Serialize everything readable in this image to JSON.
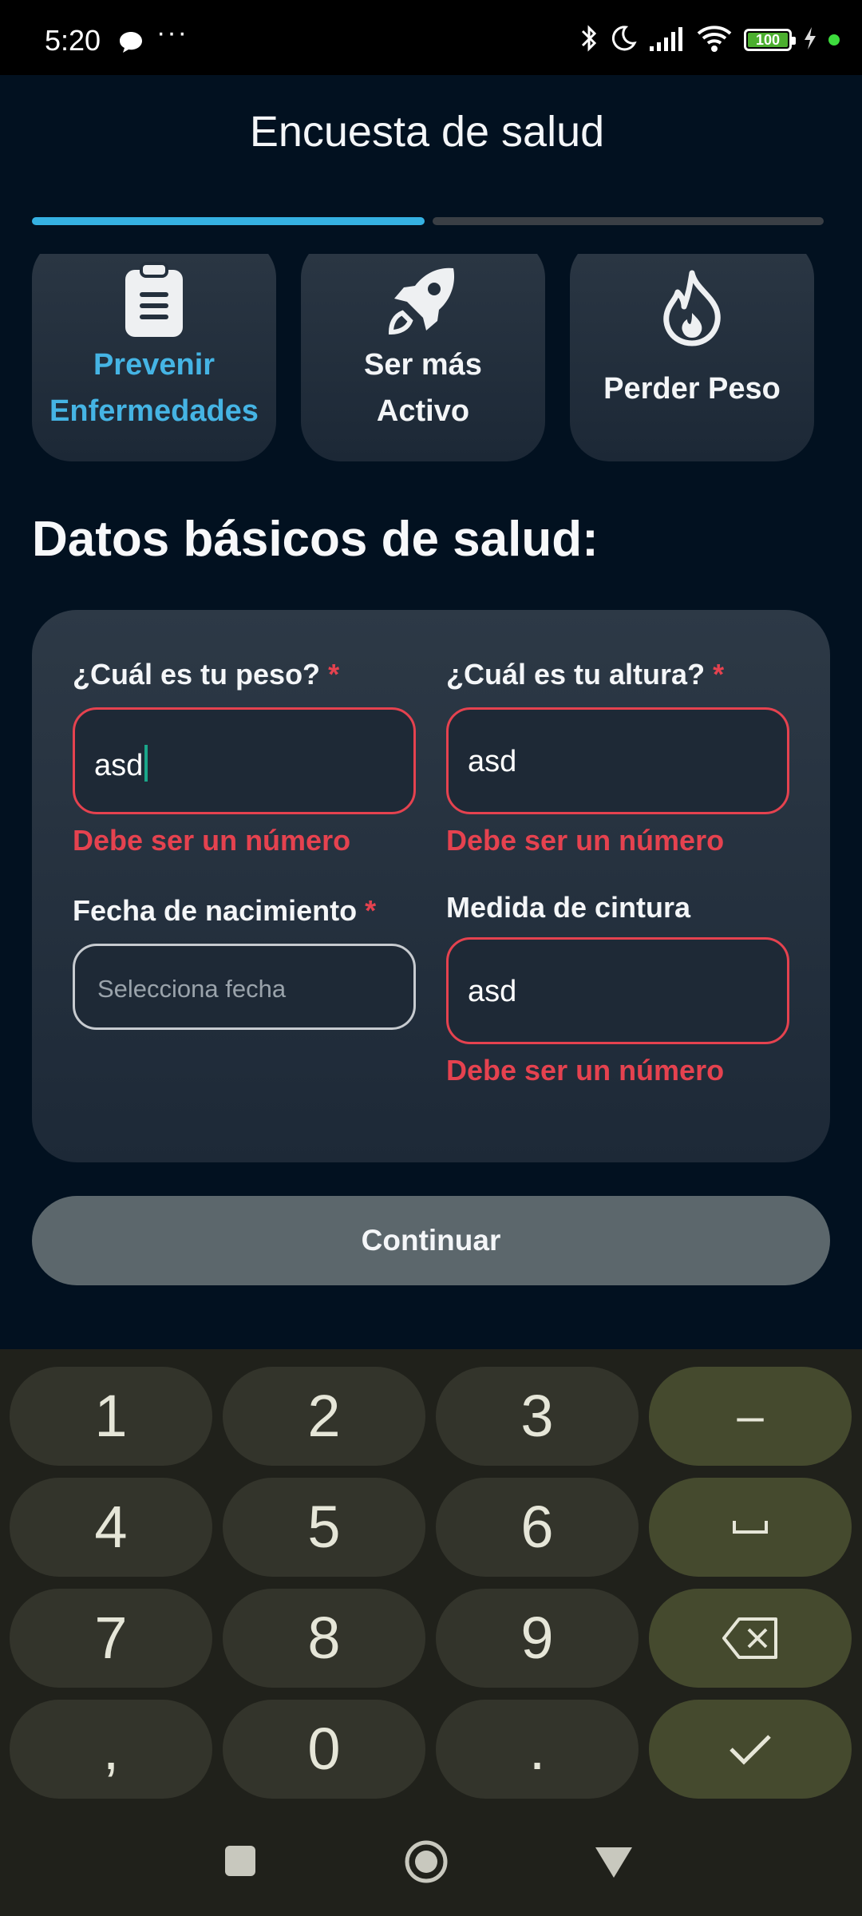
{
  "status_bar": {
    "time": "5:20",
    "battery": "100",
    "dots": "···"
  },
  "header": {
    "title": "Encuesta de salud",
    "progress_steps_total": 2,
    "progress_step_current": 1
  },
  "goals": [
    {
      "line1": "Prevenir",
      "line2": "Enfermedades",
      "icon": "clipboard-icon",
      "selected": true
    },
    {
      "line1": "Ser más",
      "line2": "Activo",
      "icon": "rocket-icon",
      "selected": false
    },
    {
      "line1": "Perder Peso",
      "icon": "flame-icon",
      "selected": false
    }
  ],
  "section_title": "Datos básicos de salud:",
  "form": {
    "weight": {
      "label": "¿Cuál es tu peso?",
      "required_mark": "*",
      "value": "asd",
      "error": "Debe ser un número"
    },
    "height": {
      "label": "¿Cuál es tu altura?",
      "required_mark": "*",
      "value": "asd",
      "error": "Debe ser un número"
    },
    "birthdate": {
      "label": "Fecha de nacimiento",
      "required_mark": "*",
      "placeholder": "Selecciona fecha"
    },
    "waist": {
      "label": "Medida de cintura",
      "value": "asd",
      "error": "Debe ser un número"
    }
  },
  "continue_button": "Continuar",
  "keyboard": {
    "keys": [
      "1",
      "2",
      "3",
      "4",
      "5",
      "6",
      "7",
      "8",
      "9",
      ",",
      "0",
      "."
    ],
    "minus": "–",
    "icons": [
      "space-icon",
      "backspace-icon",
      "check-icon"
    ]
  },
  "colors": {
    "accent": "#35b1e2",
    "error": "#e5424f",
    "background": "#021120",
    "card": "#243140"
  }
}
